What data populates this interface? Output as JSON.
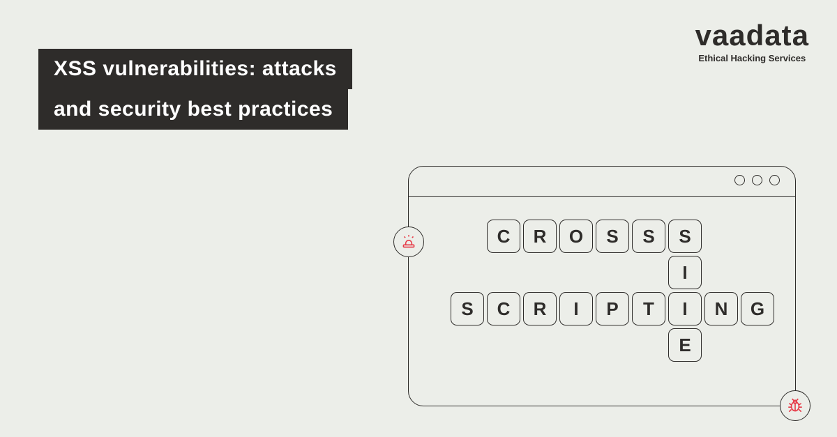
{
  "logo": {
    "text": "vaadata",
    "tagline": "Ethical Hacking Services"
  },
  "title": {
    "line1": "XSS vulnerabilities: attacks",
    "line2": "and security best practices"
  },
  "crossword": {
    "cross": [
      "C",
      "R",
      "O",
      "S",
      "S"
    ],
    "site_s": "S",
    "site_i": "I",
    "site_t_used_in_scripting": true,
    "site_e": "E",
    "scripting": [
      "S",
      "C",
      "R",
      "I",
      "P",
      "T",
      "I",
      "N",
      "G"
    ]
  },
  "icons": {
    "alert": "alert-icon",
    "bug": "bug-icon"
  }
}
